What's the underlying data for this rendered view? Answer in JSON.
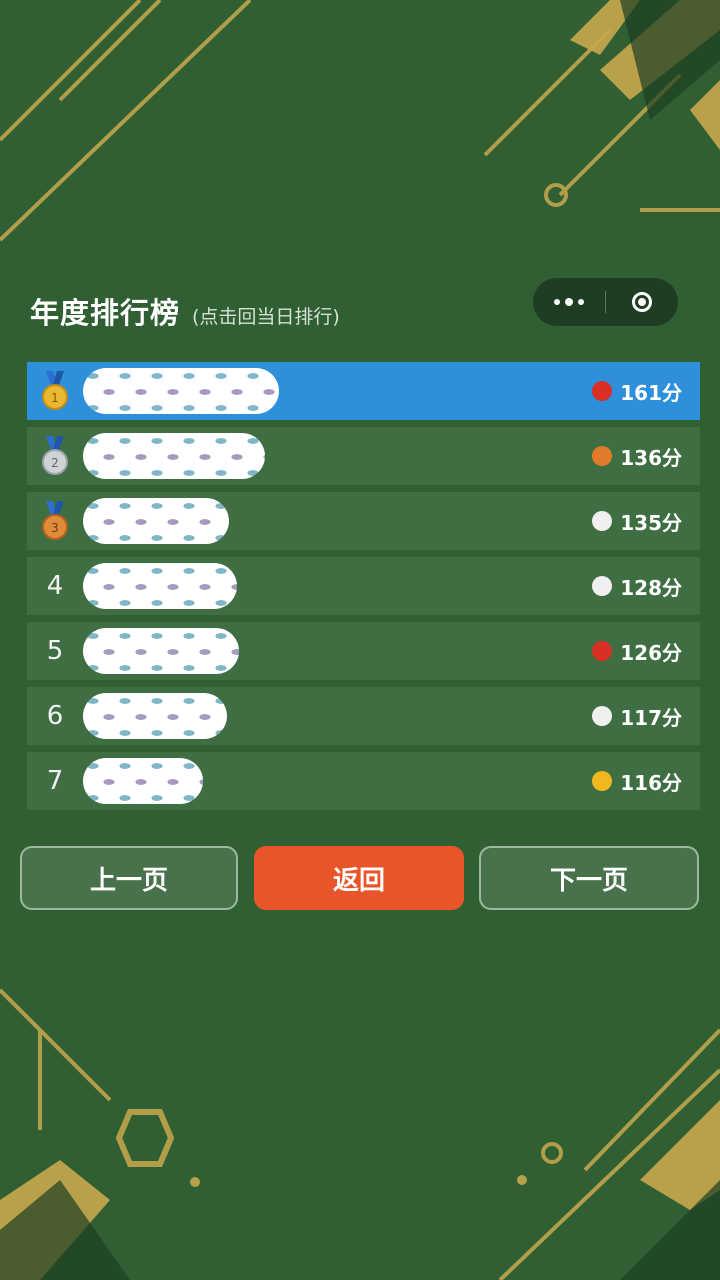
{
  "header": {
    "title": "年度排行榜",
    "subtitle": "(点击回当日排行)"
  },
  "capsule": {
    "more_icon": "more-dots-icon",
    "close_icon": "close-circle-icon"
  },
  "leaderboard": [
    {
      "rank": "1",
      "medal": "gold",
      "score": "161分",
      "ball_color": "#d92f25"
    },
    {
      "rank": "2",
      "medal": "silver",
      "score": "136分",
      "ball_color": "#e07a2a"
    },
    {
      "rank": "3",
      "medal": "bronze",
      "score": "135分",
      "ball_color": "#f0f0f0"
    },
    {
      "rank": "4",
      "medal": "",
      "score": "128分",
      "ball_color": "#f0f0f0"
    },
    {
      "rank": "5",
      "medal": "",
      "score": "126分",
      "ball_color": "#d92f25"
    },
    {
      "rank": "6",
      "medal": "",
      "score": "117分",
      "ball_color": "#f0f0f0"
    },
    {
      "rank": "7",
      "medal": "",
      "score": "116分",
      "ball_color": "#f0b81e"
    }
  ],
  "buttons": {
    "prev": "上一页",
    "back": "返回",
    "next": "下一页"
  },
  "colors": {
    "background": "#2f5f33",
    "highlight_row": "#2e8fdb",
    "back_button": "#e8552a",
    "gold_accent": "#c9a84e"
  }
}
